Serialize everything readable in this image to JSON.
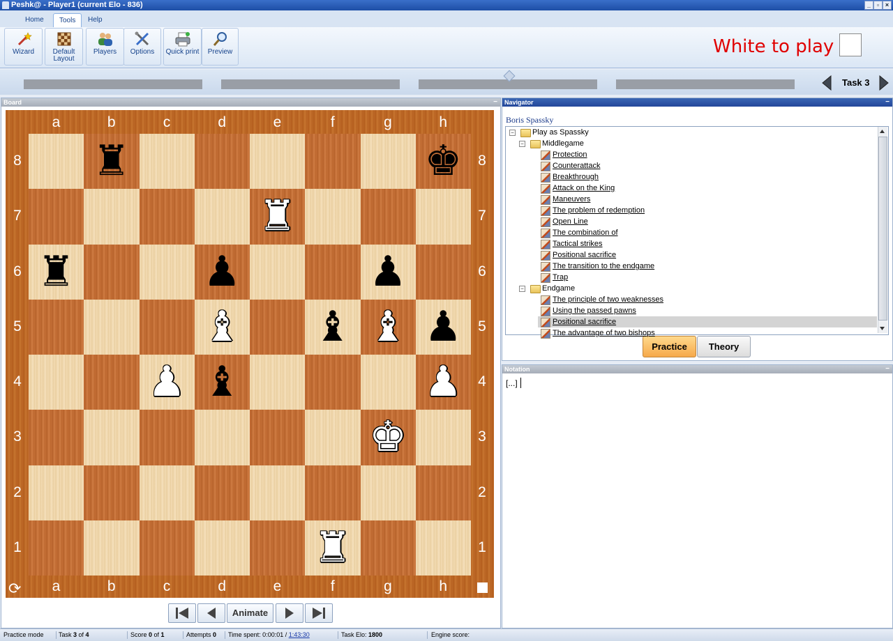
{
  "window": {
    "title": "Peshk@ - Player1 (current Elo - 836)",
    "controls": [
      "minimize-button",
      "maximize-button",
      "close-button"
    ]
  },
  "ribbon": {
    "tabs": [
      {
        "label": "Home",
        "active": false
      },
      {
        "label": "Tools",
        "active": true
      },
      {
        "label": "Help",
        "active": false
      }
    ],
    "buttons": [
      {
        "id": "wizard",
        "label": "Wizard",
        "icon": "wand-icon"
      },
      {
        "id": "default-layout",
        "label": "Default Layout",
        "line1": "Default",
        "line2": "Layout",
        "icon": "checkerboard-icon"
      },
      {
        "id": "players",
        "label": "Players",
        "icon": "users-icon"
      },
      {
        "id": "options",
        "label": "Options",
        "icon": "tools-icon"
      },
      {
        "id": "quick-print",
        "label": "Quick print",
        "icon": "printer-icon"
      },
      {
        "id": "preview",
        "label": "Preview",
        "icon": "magnifier-icon"
      }
    ],
    "turn_text": "White to play",
    "turn_color": "#e00000",
    "turn_indicator": "white"
  },
  "progress": {
    "segments": 4,
    "current_segment": 3,
    "task_label": "Task 3"
  },
  "board": {
    "panel_title": "Board",
    "files": [
      "a",
      "b",
      "c",
      "d",
      "e",
      "f",
      "g",
      "h"
    ],
    "ranks": [
      "8",
      "7",
      "6",
      "5",
      "4",
      "3",
      "2",
      "1"
    ],
    "pieces": [
      {
        "square": "b8",
        "piece": "rook",
        "color": "black",
        "glyph": "♜"
      },
      {
        "square": "h8",
        "piece": "king",
        "color": "black",
        "glyph": "♚"
      },
      {
        "square": "e7",
        "piece": "rook",
        "color": "white",
        "glyph": "♜"
      },
      {
        "square": "a6",
        "piece": "rook",
        "color": "black",
        "glyph": "♜"
      },
      {
        "square": "d6",
        "piece": "pawn",
        "color": "black",
        "glyph": "♟"
      },
      {
        "square": "g6",
        "piece": "pawn",
        "color": "black",
        "glyph": "♟"
      },
      {
        "square": "d5",
        "piece": "bishop",
        "color": "white",
        "glyph": "♝"
      },
      {
        "square": "f5",
        "piece": "bishop",
        "color": "black",
        "glyph": "♝"
      },
      {
        "square": "g5",
        "piece": "bishop",
        "color": "white",
        "glyph": "♝"
      },
      {
        "square": "h5",
        "piece": "pawn",
        "color": "black",
        "glyph": "♟"
      },
      {
        "square": "c4",
        "piece": "pawn",
        "color": "white",
        "glyph": "♟"
      },
      {
        "square": "d4",
        "piece": "bishop",
        "color": "black",
        "glyph": "♝"
      },
      {
        "square": "h4",
        "piece": "pawn",
        "color": "white",
        "glyph": "♟"
      },
      {
        "square": "g3",
        "piece": "king",
        "color": "white",
        "glyph": "♚"
      },
      {
        "square": "f1",
        "piece": "rook",
        "color": "white",
        "glyph": "♜"
      }
    ],
    "controls": {
      "first": "⏮",
      "prev": "◀",
      "animate": "Animate",
      "next": "▶",
      "last": "⏭",
      "rotate_icon": "⟳"
    }
  },
  "navigator": {
    "panel_title": "Navigator",
    "player": "Boris Spassky",
    "tree": {
      "root": "Play as Spassky",
      "groups": [
        {
          "label": "Middlegame",
          "items": [
            "Protection",
            "Counterattack",
            "Breakthrough",
            "Attack on the King",
            "Maneuvers",
            "The problem of redemption",
            "Open Line",
            "The combination of",
            "Tactical strikes",
            "Positional sacrifice",
            "The transition to the endgame",
            "Trap"
          ]
        },
        {
          "label": "Endgame",
          "items": [
            "The principle of two weaknesses",
            "Using the passed pawns",
            "Positional sacrifice",
            "The advantage of two bishops"
          ]
        }
      ],
      "selected": "Endgame / Positional sacrifice"
    },
    "buttons": {
      "practice": "Practice",
      "theory": "Theory"
    }
  },
  "notation": {
    "panel_title": "Notation",
    "text": "[...]"
  },
  "status": {
    "mode": "Practice mode",
    "task_prefix": "Task ",
    "task_num": "3",
    "task_of": " of ",
    "task_total": "4",
    "score_prefix": "Score ",
    "score_val": "0",
    "score_of": " of ",
    "score_total": "1",
    "attempts_prefix": "Attempts ",
    "attempts_val": "0",
    "time_prefix": "Time spent: 0:00:01 / ",
    "time_limit": "1:43:30",
    "elo_prefix": "Task Elo: ",
    "elo_val": "1800",
    "engine": "Engine score:"
  }
}
